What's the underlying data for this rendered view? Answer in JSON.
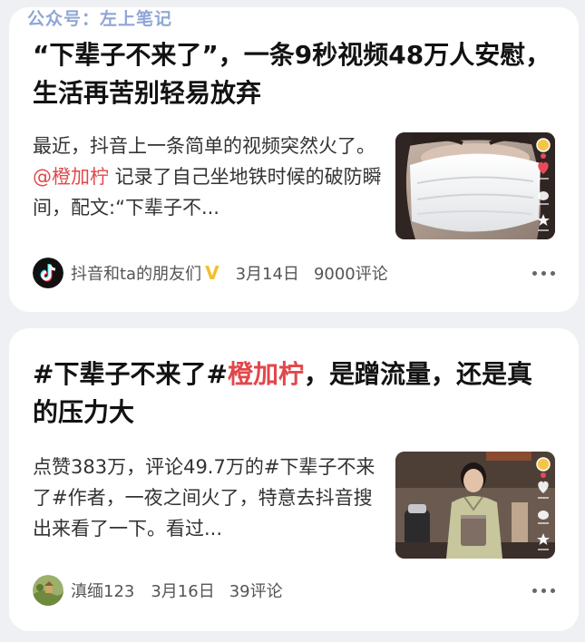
{
  "watermark": "公众号：左上笔记",
  "articles": [
    {
      "title": "“下辈子不来了”，一条9秒视频48万人安慰，生活再苦别轻易放弃",
      "snippet_before": "最近，抖音上一条简单的视频突然火了。",
      "snippet_highlight": "@橙加柠",
      "snippet_after": " 记录了自己坐地铁时候的破防瞬间，配文:“下辈子不...",
      "author": "抖音和ta的朋友们",
      "verified_mark": "V",
      "date": "3月14日",
      "comments": "9000评论",
      "avatar_icon": "douyin-logo-icon"
    },
    {
      "title_before": "#下辈子不来了#",
      "title_highlight": "橙加柠",
      "title_after": "，是蹭流量，还是真的压力大",
      "snippet": "点赞383万，评论49.7万的#下辈子不来了#作者，一夜之间火了，特意去抖音搜出来看了一下。看过...",
      "author": "滇缅123",
      "date": "3月16日",
      "comments": "39评论",
      "avatar_icon": "landscape-avatar-icon"
    }
  ],
  "colors": {
    "highlight": "#e0484b",
    "watermark": "#8fa6d6",
    "verified": "#f0c030"
  }
}
